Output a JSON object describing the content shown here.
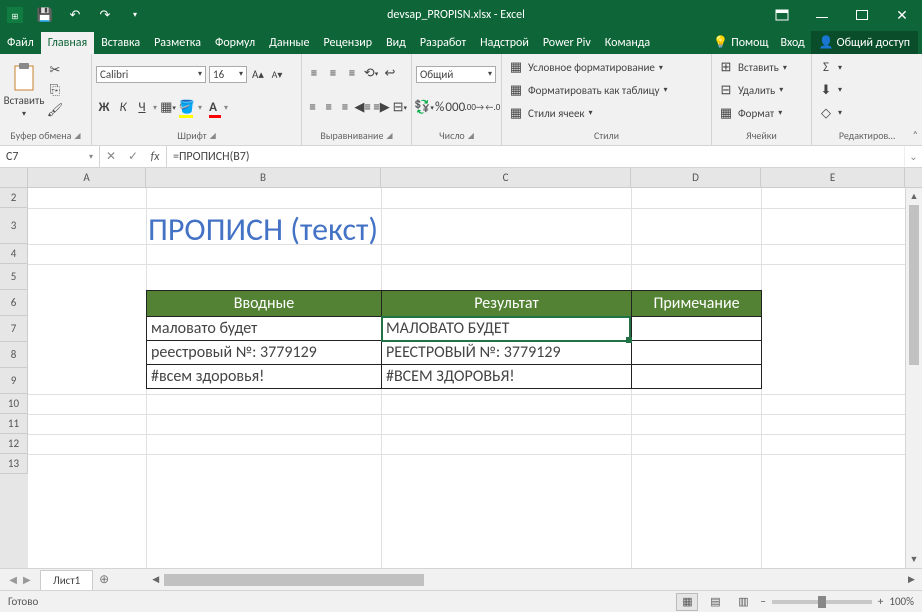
{
  "title": "devsap_PROPISN.xlsx - Excel",
  "tabs": {
    "file": "Файл",
    "home": "Главная",
    "insert": "Вставка",
    "layout": "Разметка",
    "formulas": "Формул",
    "data": "Данные",
    "review": "Рецензир",
    "view": "Вид",
    "developer": "Разработ",
    "addins": "Надстрой",
    "powerpivot": "Power Piv",
    "team": "Команда",
    "tell_me": "Помощ",
    "signin": "Вход",
    "share": "Общий доступ"
  },
  "ribbon": {
    "clipboard": {
      "label": "Буфер обмена",
      "paste": "Вставить"
    },
    "font": {
      "label": "Шрифт",
      "name": "Calibri",
      "size": "16",
      "bold": "Ж",
      "italic": "К",
      "underline": "Ч"
    },
    "alignment": {
      "label": "Выравнивание"
    },
    "number": {
      "label": "Число",
      "format": "Общий"
    },
    "styles": {
      "label": "Стили",
      "cond": "Условное форматирование",
      "table": "Форматировать как таблицу",
      "cell": "Стили ячеек"
    },
    "cells": {
      "label": "Ячейки",
      "insert": "Вставить",
      "delete": "Удалить",
      "format": "Формат"
    },
    "editing": {
      "label": "Редактиров…"
    }
  },
  "namebox": "C7",
  "formula": "=ПРОПИСН(B7)",
  "columns": [
    "A",
    "B",
    "C",
    "D",
    "E"
  ],
  "rows": [
    "2",
    "3",
    "4",
    "5",
    "6",
    "7",
    "8",
    "9",
    "10",
    "11",
    "12",
    "13"
  ],
  "big_title": "ПРОПИСН (текст)",
  "table": {
    "headers": {
      "b": "Вводные",
      "c": "Результат",
      "d": "Примечание"
    },
    "rows": [
      {
        "b": "маловато будет",
        "c": "МАЛОВАТО БУДЕТ",
        "d": ""
      },
      {
        "b": "реестровый №: 3779129",
        "c": "РЕЕСТРОВЫЙ №: 3779129",
        "d": ""
      },
      {
        "b": "#всем здоровья!",
        "c": "#ВСЕМ ЗДОРОВЬЯ!",
        "d": ""
      }
    ]
  },
  "sheet_tab": "Лист1",
  "add_sheet": "⊕",
  "status": {
    "ready": "Готово",
    "zoom": "100%"
  },
  "chart_data": null
}
